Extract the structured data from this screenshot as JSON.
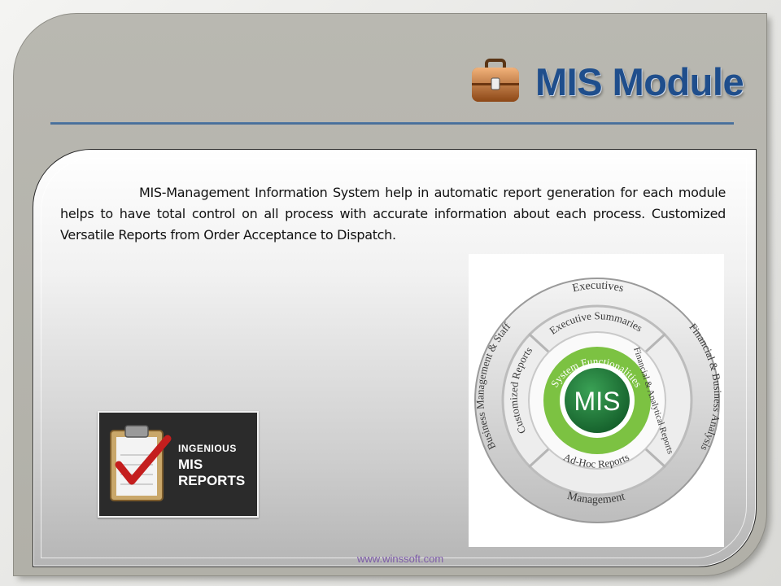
{
  "slide": {
    "title": "MIS Module",
    "icon": "briefcase-icon",
    "description": "MIS-Management Information System help in automatic report generation for each module helps to have total control on all process with accurate information about each process. Customized Versatile Reports from Order Acceptance to Dispatch.",
    "footer_url": "www.winssoft.com"
  },
  "diagram": {
    "center": "MIS",
    "inner_ring": "System Functionalities",
    "middle_ring": [
      "Executive Summaries",
      "Financial & Analytical Reports",
      "Ad-Hoc Reports",
      "Customized Reports"
    ],
    "outer_ring": [
      "Executives",
      "Financial & Business Analysis",
      "Management",
      "Business Management & Staff"
    ]
  },
  "badge": {
    "line1": "INGENIOUS",
    "line2": "MIS",
    "line3": "REPORTS",
    "icon": "clipboard-check-icon"
  },
  "colors": {
    "title": "#1f4e8c",
    "center_green": "#1e7a3a",
    "ring_green": "#7cc242",
    "link": "#7b5aa6"
  }
}
